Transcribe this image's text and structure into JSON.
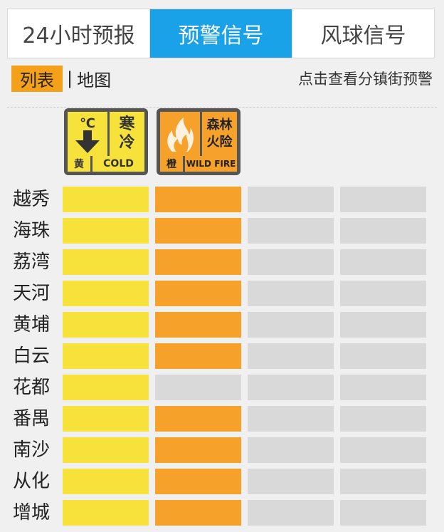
{
  "tabs": [
    "24小时预报",
    "预警信号",
    "风球信号"
  ],
  "active_tab": 1,
  "subbar": {
    "list_label": "列表",
    "separator": "|",
    "map_label": "地图",
    "hint": "点击查看分镇街预警"
  },
  "signals": [
    {
      "icon": "thermometer-arrow-icon",
      "symbol": "℃",
      "title_line1": "寒",
      "title_line2": "冷",
      "level": "黄",
      "english": "COLD",
      "color": "#f6e23a"
    },
    {
      "icon": "fire-icon",
      "symbol": "",
      "title_line1": "森林",
      "title_line2": "火险",
      "level": "橙",
      "english": "WILD FIRE",
      "color": "#f5a12a"
    }
  ],
  "colors": {
    "yellow": "#f6e23a",
    "orange": "#f5a12a",
    "none": "#d9d9d9",
    "tab_active": "#1aa2e8",
    "list_button": "#f5a01a"
  },
  "districts": [
    {
      "name": "越秀",
      "cells": [
        "yellow",
        "orange",
        "none",
        "none"
      ]
    },
    {
      "name": "海珠",
      "cells": [
        "yellow",
        "orange",
        "none",
        "none"
      ]
    },
    {
      "name": "荔湾",
      "cells": [
        "yellow",
        "orange",
        "none",
        "none"
      ]
    },
    {
      "name": "天河",
      "cells": [
        "yellow",
        "orange",
        "none",
        "none"
      ]
    },
    {
      "name": "黄埔",
      "cells": [
        "yellow",
        "orange",
        "none",
        "none"
      ]
    },
    {
      "name": "白云",
      "cells": [
        "yellow",
        "orange",
        "none",
        "none"
      ]
    },
    {
      "name": "花都",
      "cells": [
        "yellow",
        "none",
        "none",
        "none"
      ]
    },
    {
      "name": "番禺",
      "cells": [
        "yellow",
        "orange",
        "none",
        "none"
      ]
    },
    {
      "name": "南沙",
      "cells": [
        "yellow",
        "orange",
        "none",
        "none"
      ]
    },
    {
      "name": "从化",
      "cells": [
        "yellow",
        "orange",
        "none",
        "none"
      ]
    },
    {
      "name": "增城",
      "cells": [
        "yellow",
        "orange",
        "none",
        "none"
      ]
    }
  ]
}
